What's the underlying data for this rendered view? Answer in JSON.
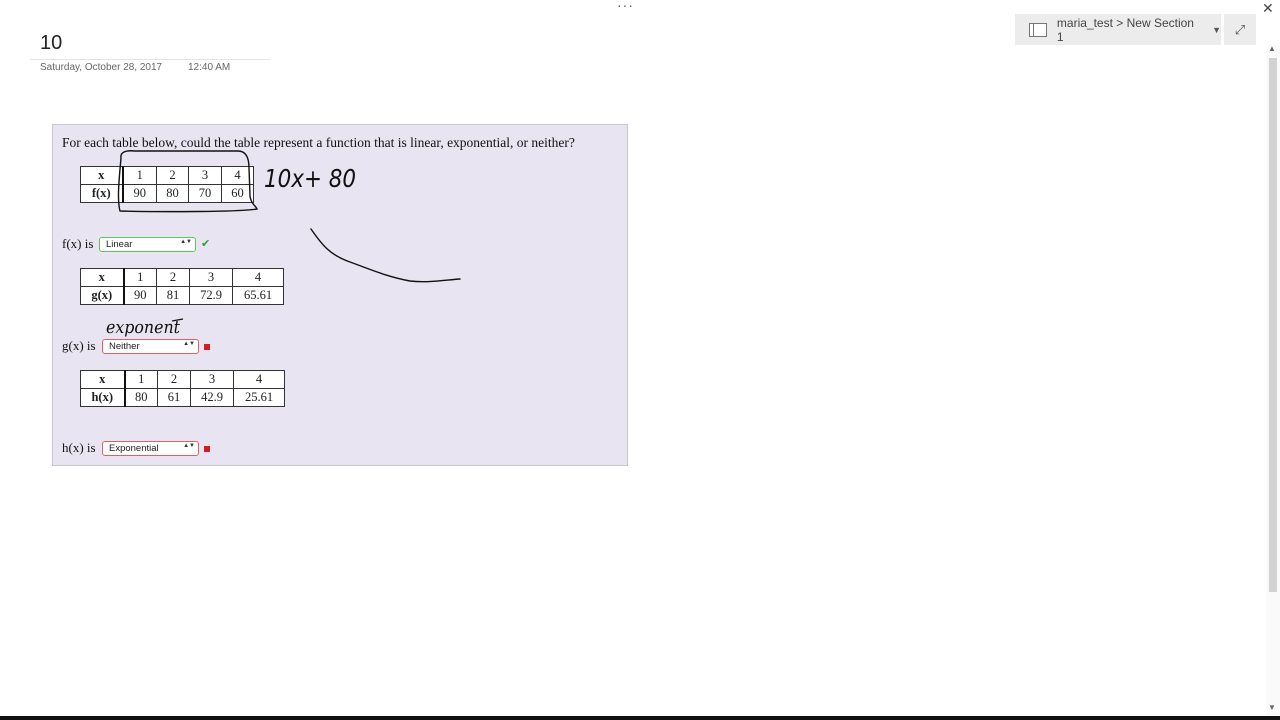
{
  "window": {
    "more_glyph": "···",
    "close_glyph": "✕"
  },
  "page": {
    "title": "10",
    "date": "Saturday, October 28, 2017",
    "time": "12:40 AM"
  },
  "notebook": {
    "location": "maria_test > New Section 1",
    "caret": "▼",
    "expand_glyph": "⤢"
  },
  "scrollbar": {
    "up": "▲",
    "down": "▼"
  },
  "problem": {
    "question": "For each table below, could the table represent a function that is linear, exponential, or neither?",
    "tables": [
      {
        "x_label": "x",
        "x": [
          "1",
          "2",
          "3",
          "4"
        ],
        "y_label": "f(x)",
        "y": [
          "90",
          "80",
          "70",
          "60"
        ],
        "answer_label": "f(x) is",
        "answer": "Linear",
        "correct": true,
        "mark": "✔"
      },
      {
        "x_label": "x",
        "x": [
          "1",
          "2",
          "3",
          "4"
        ],
        "y_label": "g(x)",
        "y": [
          "90",
          "81",
          "72.9",
          "65.61"
        ],
        "answer_label": "g(x) is",
        "answer": "Neither",
        "correct": false
      },
      {
        "x_label": "x",
        "x": [
          "1",
          "2",
          "3",
          "4"
        ],
        "y_label": "h(x)",
        "y": [
          "80",
          "61",
          "42.9",
          "25.61"
        ],
        "answer_label": "h(x) is",
        "answer": "Exponential",
        "correct": false
      }
    ],
    "dropdown_arrows": "▲▼"
  },
  "handwriting": {
    "note_1": "10x+ 80",
    "note_2": "exponent"
  }
}
